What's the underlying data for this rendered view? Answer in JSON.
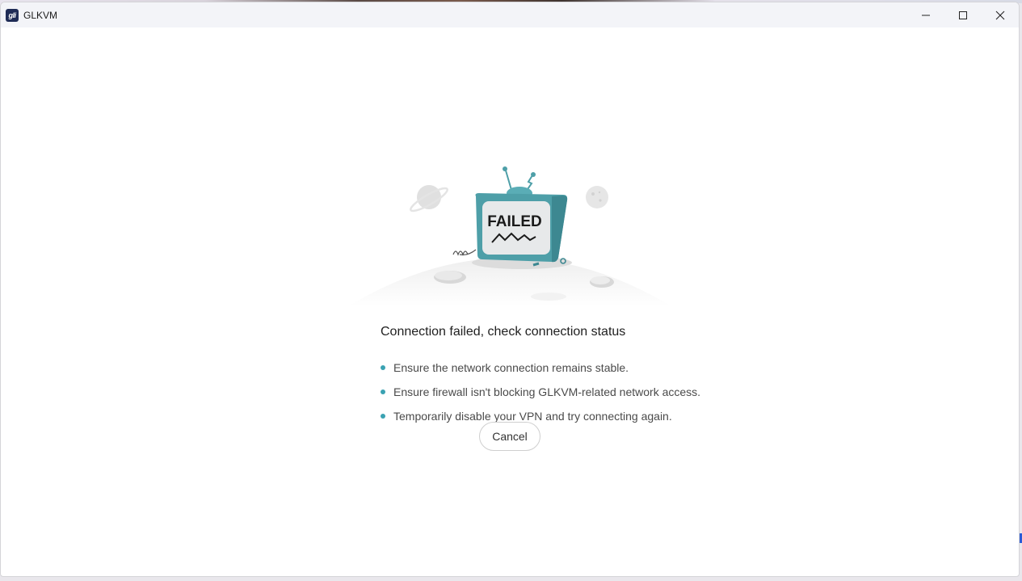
{
  "window": {
    "title": "GLKVM",
    "app_icon_text": "gli"
  },
  "illustration": {
    "screen_text": "FAILED"
  },
  "message": {
    "title": "Connection failed, check connection status",
    "tips": [
      "Ensure the network connection remains stable.",
      "Ensure firewall isn't blocking GLKVM-related network access.",
      "Temporarily disable your VPN and try connecting again."
    ]
  },
  "actions": {
    "cancel_label": "Cancel"
  },
  "colors": {
    "accent": "#3aa2b2",
    "tv_body": "#4e9fa8",
    "titlebar": "#f3f4f8"
  }
}
